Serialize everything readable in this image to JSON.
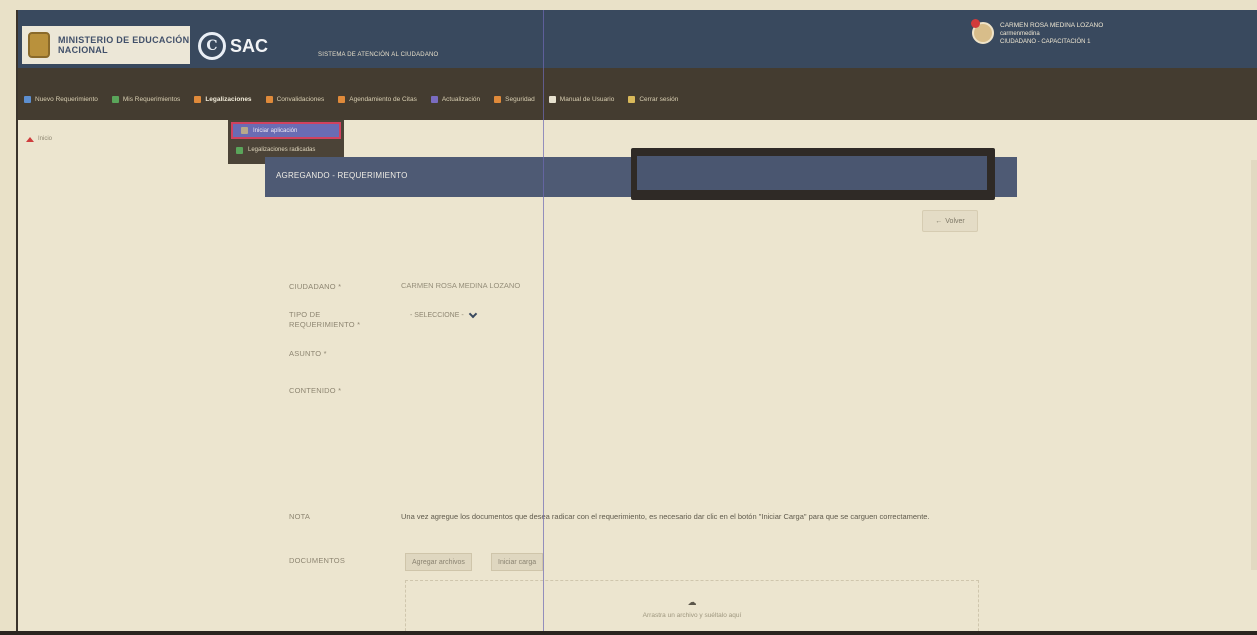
{
  "header": {
    "ministry": "MINISTERIO DE EDUCACIÓN NACIONAL",
    "ministry_line1": "MINISTERIO DE EDUCACIÓN",
    "ministry_line2": "NACIONAL",
    "logo_letter": "ⓒ",
    "app_name": "SAC",
    "system_name": "SISTEMA DE ATENCIÓN AL CIUDADANO"
  },
  "user": {
    "name": "CARMEN ROSA MEDINA LOZANO",
    "username": "carmenmedina",
    "role": "CIUDADANO - CAPACITACIÓN 1"
  },
  "nav": {
    "items": [
      {
        "label": "Nuevo Requerimiento",
        "icon": "document-plus-icon",
        "color": "#5d8fd0"
      },
      {
        "label": "Mis Requerimientos",
        "icon": "list-icon",
        "color": "#5aa55a"
      },
      {
        "label": "Legalizaciones",
        "icon": "arrow-icon",
        "color": "#e08a3a",
        "active": true
      },
      {
        "label": "Convalidaciones",
        "icon": "arrow-icon",
        "color": "#e08a3a"
      },
      {
        "label": "Agendamiento de Citas",
        "icon": "arrow-icon",
        "color": "#e08a3a"
      },
      {
        "label": "Actualización",
        "icon": "arrow-icon",
        "color": "#7a6cc0"
      },
      {
        "label": "Seguridad",
        "icon": "arrow-icon",
        "color": "#e08a3a"
      },
      {
        "label": "Manual de Usuario",
        "icon": "book-icon",
        "color": "#e7e1cf"
      },
      {
        "label": "Cerrar sesión",
        "icon": "logout-icon",
        "color": "#d9b95a"
      }
    ]
  },
  "dropdown": {
    "items": [
      {
        "label": "Iniciar aplicación",
        "selected": true
      },
      {
        "label": "Legalizaciones radicadas",
        "selected": false
      }
    ]
  },
  "breadcrumb": {
    "label": "Inicio"
  },
  "page": {
    "title": "AGREGANDO - REQUERIMIENTO",
    "back_label": "Volver"
  },
  "form": {
    "ciudadano_label": "CIUDADANO *",
    "ciudadano_value": "CARMEN ROSA MEDINA LOZANO",
    "tipo_label_1": "TIPO DE",
    "tipo_label_2": "REQUERIMIENTO *",
    "tipo_value": "- SELECCIONE -",
    "asunto_label": "ASUNTO *",
    "contenido_label": "CONTENIDO *",
    "nota_label": "NOTA",
    "nota_text": "Una vez agregue los documentos que desea radicar con el requerimiento, es necesario dar clic en el botón \"Iniciar Carga\" para que se carguen correctamente.",
    "documentos_label": "DOCUMENTOS",
    "add_files_button": "Agregar archivos",
    "start_upload_button": "Iniciar carga",
    "dropzone_text": "Arrastra un archivo y suéltalo aquí"
  }
}
